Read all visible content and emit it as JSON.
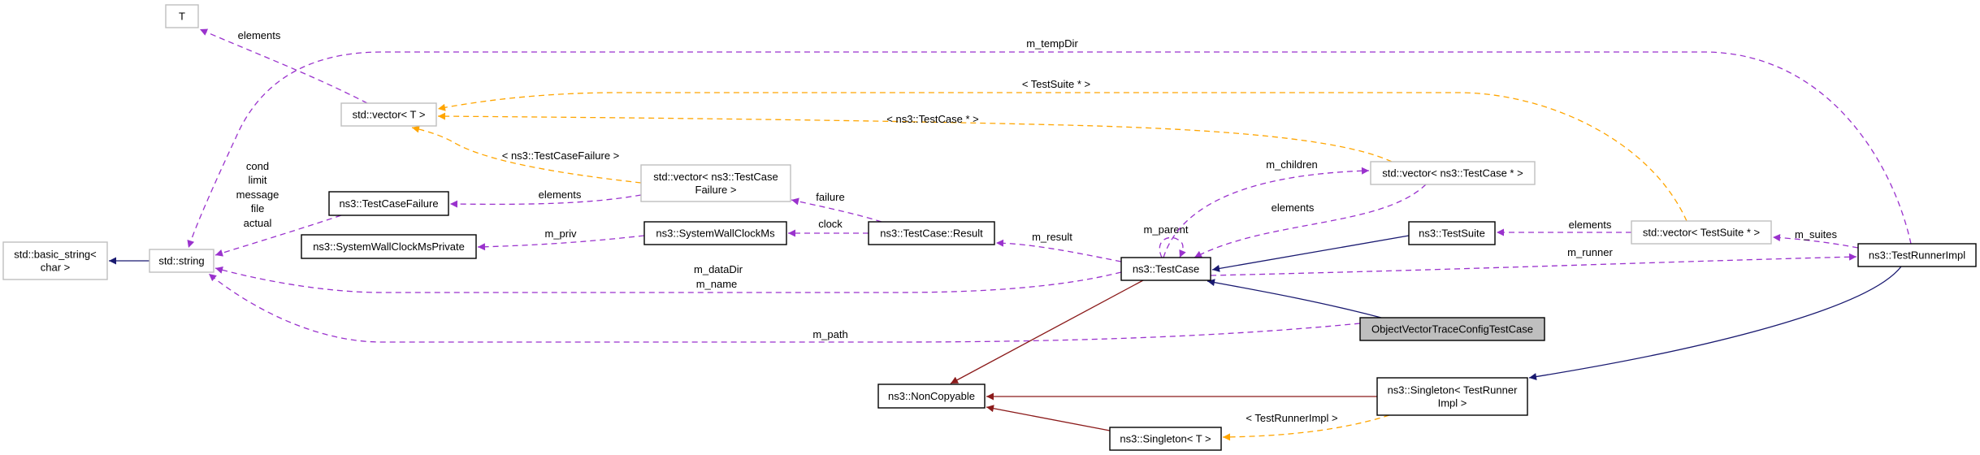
{
  "colors": {
    "usage": "#9a32cd",
    "template": "#ffa500",
    "inheritance": "#191970",
    "private_inheritance": "#8b1a1a",
    "highlight_fill": "#bfbfbf",
    "external_border": "#bfbfbf"
  },
  "nodes": {
    "T": {
      "lines": [
        "T"
      ],
      "kind": "external"
    },
    "vector_T": {
      "lines": [
        "std::vector< T >"
      ],
      "kind": "external"
    },
    "basic_string": {
      "lines": [
        "std::basic_string<",
        "char >"
      ],
      "kind": "external"
    },
    "string": {
      "lines": [
        "std::string"
      ],
      "kind": "external"
    },
    "TestCaseFailure": {
      "lines": [
        "ns3::TestCaseFailure"
      ],
      "kind": "class"
    },
    "vector_TCF": {
      "lines": [
        "std::vector< ns3::TestCase",
        "Failure >"
      ],
      "kind": "external"
    },
    "SWCMPrivate": {
      "lines": [
        "ns3::SystemWallClockMsPrivate"
      ],
      "kind": "class"
    },
    "SWCMs": {
      "lines": [
        "ns3::SystemWallClockMs"
      ],
      "kind": "class"
    },
    "Result": {
      "lines": [
        "ns3::TestCase::Result"
      ],
      "kind": "class"
    },
    "TestCase": {
      "lines": [
        "ns3::TestCase"
      ],
      "kind": "class"
    },
    "vector_TC": {
      "lines": [
        "std::vector< ns3::TestCase * >"
      ],
      "kind": "external"
    },
    "TestSuite": {
      "lines": [
        "ns3::TestSuite"
      ],
      "kind": "class"
    },
    "vector_TS": {
      "lines": [
        "std::vector< TestSuite * >"
      ],
      "kind": "external"
    },
    "TestRunnerImpl": {
      "lines": [
        "ns3::TestRunnerImpl"
      ],
      "kind": "class"
    },
    "ObjectVector": {
      "lines": [
        "ObjectVectorTraceConfigTestCase"
      ],
      "kind": "highlight"
    },
    "NonCopyable": {
      "lines": [
        "ns3::NonCopyable"
      ],
      "kind": "class"
    },
    "SingletonTRI": {
      "lines": [
        "ns3::Singleton< TestRunner",
        "Impl >"
      ],
      "kind": "class"
    },
    "SingletonT": {
      "lines": [
        "ns3::Singleton< T >"
      ],
      "kind": "class"
    }
  },
  "edges": [
    {
      "id": "e1",
      "from": "vector_T",
      "to": "T",
      "type": "usage",
      "label": [
        "elements"
      ]
    },
    {
      "id": "e2",
      "from": "TestRunnerImpl",
      "to": "string",
      "type": "usage",
      "label": [
        "m_tempDir"
      ]
    },
    {
      "id": "e3",
      "from": "vector_TS",
      "to": "vector_T",
      "type": "template",
      "label": [
        "< TestSuite * >"
      ]
    },
    {
      "id": "e4",
      "from": "vector_TC",
      "to": "vector_T",
      "type": "template",
      "label": [
        "< ns3::TestCase * >"
      ]
    },
    {
      "id": "e5",
      "from": "vector_TCF",
      "to": "vector_T",
      "type": "template",
      "label": [
        "< ns3::TestCaseFailure >"
      ]
    },
    {
      "id": "e6",
      "from": "vector_TCF",
      "to": "TestCaseFailure",
      "type": "usage",
      "label": [
        "elements"
      ]
    },
    {
      "id": "e7",
      "from": "TestCaseFailure",
      "to": "string",
      "type": "usage",
      "label": [
        "cond",
        "limit",
        "message",
        "file",
        "actual"
      ]
    },
    {
      "id": "e8",
      "from": "SWCMs",
      "to": "SWCMPrivate",
      "type": "usage",
      "label": [
        "m_priv"
      ]
    },
    {
      "id": "e9",
      "from": "Result",
      "to": "SWCMs",
      "type": "usage",
      "label": [
        "clock"
      ]
    },
    {
      "id": "e10",
      "from": "Result",
      "to": "vector_TCF",
      "type": "usage",
      "label": [
        "failure"
      ]
    },
    {
      "id": "e11",
      "from": "TestCase",
      "to": "Result",
      "type": "usage",
      "label": [
        "m_result"
      ]
    },
    {
      "id": "e12",
      "from": "TestCase",
      "to": "string",
      "type": "usage",
      "label": [
        "m_dataDir",
        "m_name"
      ]
    },
    {
      "id": "e13",
      "from": "ObjectVector",
      "to": "string",
      "type": "usage",
      "label": [
        "m_path"
      ]
    },
    {
      "id": "e14",
      "from": "TestCase",
      "to": "TestCase",
      "type": "usage",
      "label": [
        "m_parent"
      ]
    },
    {
      "id": "e15",
      "from": "TestCase",
      "to": "vector_TC",
      "type": "usage",
      "label": [
        "m_children"
      ]
    },
    {
      "id": "e16",
      "from": "vector_TC",
      "to": "TestCase",
      "type": "usage",
      "label": [
        "elements"
      ]
    },
    {
      "id": "e17",
      "from": "TestSuite",
      "to": "TestCase",
      "type": "inheritance",
      "label": []
    },
    {
      "id": "e18",
      "from": "vector_TS",
      "to": "TestSuite",
      "type": "usage",
      "label": [
        "elements"
      ]
    },
    {
      "id": "e19",
      "from": "TestRunnerImpl",
      "to": "vector_TS",
      "type": "usage",
      "label": [
        "m_suites"
      ]
    },
    {
      "id": "e20",
      "from": "TestCase",
      "to": "TestRunnerImpl",
      "type": "usage",
      "label": [
        "m_runner"
      ]
    },
    {
      "id": "e21",
      "from": "ObjectVector",
      "to": "TestCase",
      "type": "inheritance",
      "label": []
    },
    {
      "id": "e22",
      "from": "TestCase",
      "to": "NonCopyable",
      "type": "private_inheritance",
      "label": []
    },
    {
      "id": "e23",
      "from": "SingletonTRI",
      "to": "NonCopyable",
      "type": "private_inheritance",
      "label": []
    },
    {
      "id": "e24",
      "from": "SingletonT",
      "to": "NonCopyable",
      "type": "private_inheritance",
      "label": []
    },
    {
      "id": "e25",
      "from": "SingletonTRI",
      "to": "SingletonT",
      "type": "template",
      "label": [
        "< TestRunnerImpl >"
      ]
    },
    {
      "id": "e26",
      "from": "TestRunnerImpl",
      "to": "SingletonTRI",
      "type": "inheritance",
      "label": []
    },
    {
      "id": "e27",
      "from": "string",
      "to": "basic_string",
      "type": "inheritance",
      "label": []
    }
  ]
}
